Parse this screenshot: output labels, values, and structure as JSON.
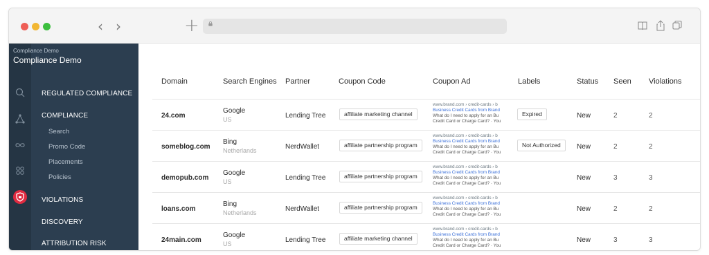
{
  "browser": {
    "back_glyph": "‹",
    "forward_glyph": "›",
    "new_tab_glyph": "+"
  },
  "sidebar": {
    "brand_small": "Compliance Demo",
    "brand_title": "Compliance Demo",
    "rail_icons": [
      "search-icon",
      "triangle-nodes-icon",
      "infinity-icon",
      "grid-icon",
      "shield-icon"
    ],
    "items": [
      {
        "label": "REGULATED COMPLIANCE"
      },
      {
        "label": "COMPLIANCE"
      },
      {
        "label": "VIOLATIONS"
      },
      {
        "label": "DISCOVERY"
      },
      {
        "label": "ATTRIBUTION RISK"
      }
    ],
    "subitems": [
      {
        "label": "Search"
      },
      {
        "label": "Promo Code"
      },
      {
        "label": "Placements"
      },
      {
        "label": "Policies"
      }
    ]
  },
  "table": {
    "headers": [
      "Domain",
      "Search Engines",
      "Partner",
      "Coupon Code",
      "Coupon Ad",
      "Labels",
      "Status",
      "Seen",
      "Violations"
    ],
    "rows": [
      {
        "domain": "24.com",
        "engine": "Google",
        "country": "US",
        "partner": "Lending Tree",
        "coupon": "affiliate marketing channel",
        "ad_url": "www.brand.com › credit-cards › b",
        "ad_title": "Business Credit Cards from Brand",
        "ad_desc1": "What do I need to apply for an Bu",
        "ad_desc2": "Credit Card or Charge Card? · You",
        "label": "Expired",
        "status": "New",
        "seen": "2",
        "violations": "2"
      },
      {
        "domain": "someblog.com",
        "engine": "Bing",
        "country": "Netherlands",
        "partner": "NerdWallet",
        "coupon": "affiliate partnership program",
        "ad_url": "www.brand.com › credit-cards › b",
        "ad_title": "Business Credit Cards from Brand",
        "ad_desc1": "What do I need to apply for an Bu",
        "ad_desc2": "Credit Card or Charge Card? · You",
        "label": "Not Authorized",
        "status": "New",
        "seen": "2",
        "violations": "2"
      },
      {
        "domain": "demopub.com",
        "engine": "Google",
        "country": "US",
        "partner": "Lending Tree",
        "coupon": "affiliate partnership program",
        "ad_url": "www.brand.com › credit-cards › b",
        "ad_title": "Business Credit Cards from Brand",
        "ad_desc1": "What do I need to apply for an Bu",
        "ad_desc2": "Credit Card or Charge Card? · You",
        "label": "",
        "status": "New",
        "seen": "3",
        "violations": "3"
      },
      {
        "domain": "loans.com",
        "engine": "Bing",
        "country": "Netherlands",
        "partner": "NerdWallet",
        "coupon": "affiliate partnership program",
        "ad_url": "www.brand.com › credit-cards › b",
        "ad_title": "Business Credit Cards from Brand",
        "ad_desc1": "What do I need to apply for an Bu",
        "ad_desc2": "Credit Card or Charge Card? · You",
        "label": "",
        "status": "New",
        "seen": "2",
        "violations": "2"
      },
      {
        "domain": "24main.com",
        "engine": "Google",
        "country": "US",
        "partner": "Lending Tree",
        "coupon": "affiliate marketing channel",
        "ad_url": "www.brand.com › credit-cards › b",
        "ad_title": "Business Credit Cards from Brand",
        "ad_desc1": "What do I need to apply for an Bu",
        "ad_desc2": "Credit Card or Charge Card? · You",
        "label": "",
        "status": "New",
        "seen": "3",
        "violations": "3"
      }
    ]
  },
  "colors": {
    "sidebar_bg": "#2c3e50",
    "rail_bg": "#253544",
    "accent_red": "#e02b41",
    "ad_link_blue": "#3a6fd8"
  }
}
